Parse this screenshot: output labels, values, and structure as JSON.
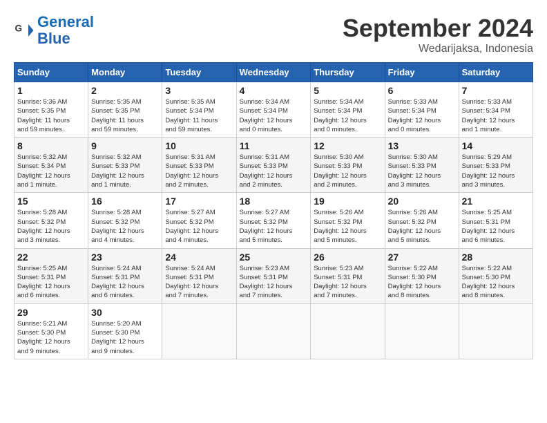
{
  "header": {
    "logo_line1": "General",
    "logo_line2": "Blue",
    "month": "September 2024",
    "location": "Wedarijaksa, Indonesia"
  },
  "weekdays": [
    "Sunday",
    "Monday",
    "Tuesday",
    "Wednesday",
    "Thursday",
    "Friday",
    "Saturday"
  ],
  "weeks": [
    [
      {
        "day": "1",
        "info": "Sunrise: 5:36 AM\nSunset: 5:35 PM\nDaylight: 11 hours\nand 59 minutes."
      },
      {
        "day": "2",
        "info": "Sunrise: 5:35 AM\nSunset: 5:35 PM\nDaylight: 11 hours\nand 59 minutes."
      },
      {
        "day": "3",
        "info": "Sunrise: 5:35 AM\nSunset: 5:34 PM\nDaylight: 11 hours\nand 59 minutes."
      },
      {
        "day": "4",
        "info": "Sunrise: 5:34 AM\nSunset: 5:34 PM\nDaylight: 12 hours\nand 0 minutes."
      },
      {
        "day": "5",
        "info": "Sunrise: 5:34 AM\nSunset: 5:34 PM\nDaylight: 12 hours\nand 0 minutes."
      },
      {
        "day": "6",
        "info": "Sunrise: 5:33 AM\nSunset: 5:34 PM\nDaylight: 12 hours\nand 0 minutes."
      },
      {
        "day": "7",
        "info": "Sunrise: 5:33 AM\nSunset: 5:34 PM\nDaylight: 12 hours\nand 1 minute."
      }
    ],
    [
      {
        "day": "8",
        "info": "Sunrise: 5:32 AM\nSunset: 5:34 PM\nDaylight: 12 hours\nand 1 minute."
      },
      {
        "day": "9",
        "info": "Sunrise: 5:32 AM\nSunset: 5:33 PM\nDaylight: 12 hours\nand 1 minute."
      },
      {
        "day": "10",
        "info": "Sunrise: 5:31 AM\nSunset: 5:33 PM\nDaylight: 12 hours\nand 2 minutes."
      },
      {
        "day": "11",
        "info": "Sunrise: 5:31 AM\nSunset: 5:33 PM\nDaylight: 12 hours\nand 2 minutes."
      },
      {
        "day": "12",
        "info": "Sunrise: 5:30 AM\nSunset: 5:33 PM\nDaylight: 12 hours\nand 2 minutes."
      },
      {
        "day": "13",
        "info": "Sunrise: 5:30 AM\nSunset: 5:33 PM\nDaylight: 12 hours\nand 3 minutes."
      },
      {
        "day": "14",
        "info": "Sunrise: 5:29 AM\nSunset: 5:33 PM\nDaylight: 12 hours\nand 3 minutes."
      }
    ],
    [
      {
        "day": "15",
        "info": "Sunrise: 5:28 AM\nSunset: 5:32 PM\nDaylight: 12 hours\nand 3 minutes."
      },
      {
        "day": "16",
        "info": "Sunrise: 5:28 AM\nSunset: 5:32 PM\nDaylight: 12 hours\nand 4 minutes."
      },
      {
        "day": "17",
        "info": "Sunrise: 5:27 AM\nSunset: 5:32 PM\nDaylight: 12 hours\nand 4 minutes."
      },
      {
        "day": "18",
        "info": "Sunrise: 5:27 AM\nSunset: 5:32 PM\nDaylight: 12 hours\nand 5 minutes."
      },
      {
        "day": "19",
        "info": "Sunrise: 5:26 AM\nSunset: 5:32 PM\nDaylight: 12 hours\nand 5 minutes."
      },
      {
        "day": "20",
        "info": "Sunrise: 5:26 AM\nSunset: 5:32 PM\nDaylight: 12 hours\nand 5 minutes."
      },
      {
        "day": "21",
        "info": "Sunrise: 5:25 AM\nSunset: 5:31 PM\nDaylight: 12 hours\nand 6 minutes."
      }
    ],
    [
      {
        "day": "22",
        "info": "Sunrise: 5:25 AM\nSunset: 5:31 PM\nDaylight: 12 hours\nand 6 minutes."
      },
      {
        "day": "23",
        "info": "Sunrise: 5:24 AM\nSunset: 5:31 PM\nDaylight: 12 hours\nand 6 minutes."
      },
      {
        "day": "24",
        "info": "Sunrise: 5:24 AM\nSunset: 5:31 PM\nDaylight: 12 hours\nand 7 minutes."
      },
      {
        "day": "25",
        "info": "Sunrise: 5:23 AM\nSunset: 5:31 PM\nDaylight: 12 hours\nand 7 minutes."
      },
      {
        "day": "26",
        "info": "Sunrise: 5:23 AM\nSunset: 5:31 PM\nDaylight: 12 hours\nand 7 minutes."
      },
      {
        "day": "27",
        "info": "Sunrise: 5:22 AM\nSunset: 5:30 PM\nDaylight: 12 hours\nand 8 minutes."
      },
      {
        "day": "28",
        "info": "Sunrise: 5:22 AM\nSunset: 5:30 PM\nDaylight: 12 hours\nand 8 minutes."
      }
    ],
    [
      {
        "day": "29",
        "info": "Sunrise: 5:21 AM\nSunset: 5:30 PM\nDaylight: 12 hours\nand 9 minutes."
      },
      {
        "day": "30",
        "info": "Sunrise: 5:20 AM\nSunset: 5:30 PM\nDaylight: 12 hours\nand 9 minutes."
      },
      {
        "day": "",
        "info": ""
      },
      {
        "day": "",
        "info": ""
      },
      {
        "day": "",
        "info": ""
      },
      {
        "day": "",
        "info": ""
      },
      {
        "day": "",
        "info": ""
      }
    ]
  ]
}
